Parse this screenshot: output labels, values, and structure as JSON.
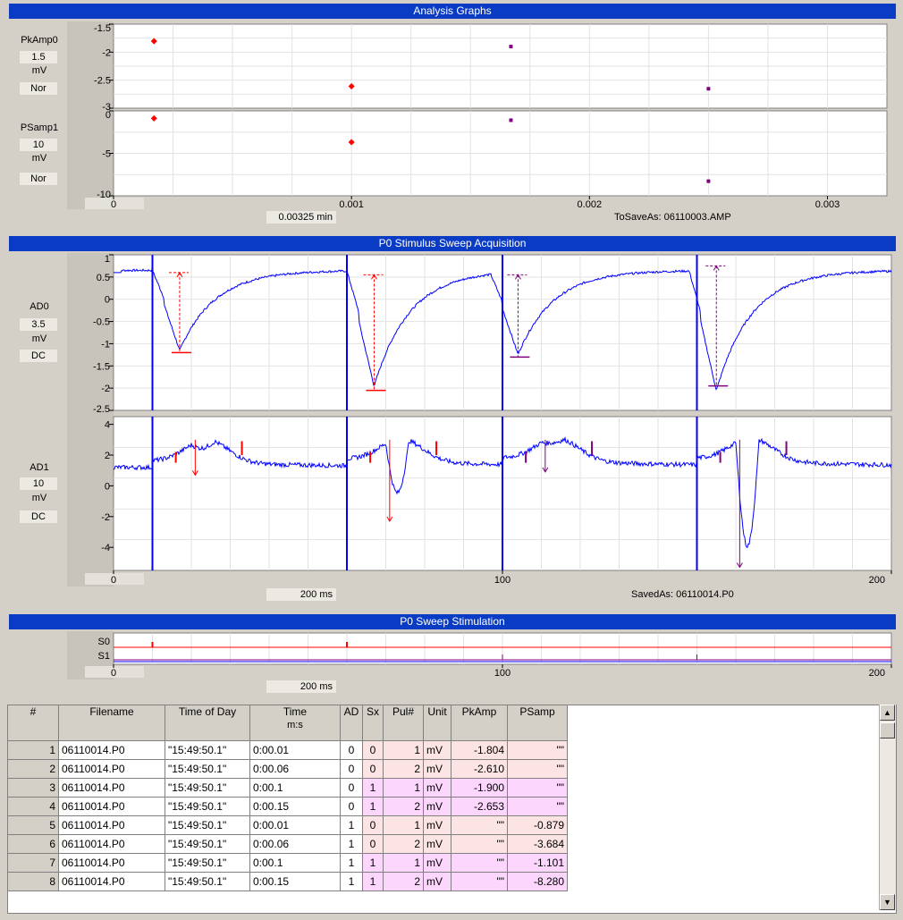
{
  "panels": {
    "analysis": {
      "title": "Analysis Graphs",
      "channels": [
        {
          "name": "PkAmp0",
          "scale": "1.5",
          "unit": "mV",
          "mode": "Nor",
          "yticks": [
            "-1.5",
            "-2",
            "-2.5",
            "-3"
          ]
        },
        {
          "name": "PSamp1",
          "scale": "10",
          "unit": "mV",
          "mode": "Nor",
          "yticks": [
            "0",
            "-5",
            "-10"
          ]
        }
      ],
      "xticks": [
        "0",
        "0.001",
        "0.002",
        "0.003"
      ],
      "xspan": "0.00325 min",
      "file_label": "ToSaveAs: 06110003.AMP"
    },
    "acquisition": {
      "title": "P0 Stimulus Sweep Acquisition",
      "channels": [
        {
          "name": "AD0",
          "scale": "3.5",
          "unit": "mV",
          "mode": "DC",
          "yticks": [
            "1",
            "0.5",
            "0",
            "-0.5",
            "-1",
            "-1.5",
            "-2",
            "-2.5"
          ]
        },
        {
          "name": "AD1",
          "scale": "10",
          "unit": "mV",
          "mode": "DC",
          "yticks": [
            "4",
            "2",
            "0",
            "-2",
            "-4"
          ]
        }
      ],
      "xticks": [
        "0",
        "100",
        "200"
      ],
      "xspan": "200 ms",
      "file_label": "SavedAs: 06110014.P0"
    },
    "stimulation": {
      "title": "P0 Sweep Stimulation",
      "channels": [
        "S0",
        "S1"
      ],
      "xticks": [
        "0",
        "100",
        "200"
      ],
      "xspan": "200 ms"
    }
  },
  "chart_data": [
    {
      "type": "scatter",
      "title": "PkAmp0",
      "ylim": [
        -3,
        -1.5
      ],
      "xlim": [
        0,
        0.00325
      ],
      "series": [
        {
          "values": [
            [
              0.00017,
              -1.804
            ],
            [
              0.001,
              -2.61
            ]
          ]
        },
        {
          "values": [
            [
              0.00167,
              -1.9
            ],
            [
              0.0025,
              -2.653
            ]
          ]
        }
      ]
    },
    {
      "type": "scatter",
      "title": "PSamp1",
      "ylim": [
        -10,
        0
      ],
      "xlim": [
        0,
        0.00325
      ],
      "series": [
        {
          "values": [
            [
              0.00017,
              -0.879
            ],
            [
              0.001,
              -3.684
            ]
          ]
        },
        {
          "values": [
            [
              0.00167,
              -1.101
            ],
            [
              0.0025,
              -8.28
            ]
          ]
        }
      ]
    },
    {
      "type": "line",
      "title": "AD0",
      "xlim": [
        0,
        200
      ],
      "ylim": [
        -2.5,
        1
      ],
      "stim_times": [
        10,
        60,
        100,
        150
      ],
      "peaks": [
        {
          "t": 17,
          "baseline": 0.6,
          "peak": -1.2
        },
        {
          "t": 67,
          "baseline": 0.55,
          "peak": -2.05
        },
        {
          "t": 104,
          "baseline": 0.55,
          "peak": -1.3
        },
        {
          "t": 155,
          "baseline": 0.75,
          "peak": -1.95
        }
      ]
    },
    {
      "type": "line",
      "title": "AD1",
      "xlim": [
        0,
        200
      ],
      "ylim": [
        -5.5,
        4.5
      ],
      "stim_times": [
        10,
        60,
        100,
        150
      ]
    }
  ],
  "table": {
    "headers": [
      "#",
      "Filename",
      "Time of Day",
      "Time\nm:s",
      "AD",
      "Sx",
      "Pul#",
      "Unit",
      "PkAmp",
      "PSamp"
    ],
    "header_time_line1": "Time",
    "header_time_line2": "m:s",
    "rows": [
      {
        "n": "1",
        "file": "06110014.P0",
        "tod": "\"15:49:50.1\"",
        "time": "0:00.01",
        "ad": "0",
        "sx": "0",
        "pul": "1",
        "unit": "mV",
        "pk": "-1.804",
        "ps": "\"\""
      },
      {
        "n": "2",
        "file": "06110014.P0",
        "tod": "\"15:49:50.1\"",
        "time": "0:00.06",
        "ad": "0",
        "sx": "0",
        "pul": "2",
        "unit": "mV",
        "pk": "-2.610",
        "ps": "\"\""
      },
      {
        "n": "3",
        "file": "06110014.P0",
        "tod": "\"15:49:50.1\"",
        "time": "0:00.1",
        "ad": "0",
        "sx": "1",
        "pul": "1",
        "unit": "mV",
        "pk": "-1.900",
        "ps": "\"\""
      },
      {
        "n": "4",
        "file": "06110014.P0",
        "tod": "\"15:49:50.1\"",
        "time": "0:00.15",
        "ad": "0",
        "sx": "1",
        "pul": "2",
        "unit": "mV",
        "pk": "-2.653",
        "ps": "\"\""
      },
      {
        "n": "5",
        "file": "06110014.P0",
        "tod": "\"15:49:50.1\"",
        "time": "0:00.01",
        "ad": "1",
        "sx": "0",
        "pul": "1",
        "unit": "mV",
        "pk": "\"\"",
        "ps": "-0.879"
      },
      {
        "n": "6",
        "file": "06110014.P0",
        "tod": "\"15:49:50.1\"",
        "time": "0:00.06",
        "ad": "1",
        "sx": "0",
        "pul": "2",
        "unit": "mV",
        "pk": "\"\"",
        "ps": "-3.684"
      },
      {
        "n": "7",
        "file": "06110014.P0",
        "tod": "\"15:49:50.1\"",
        "time": "0:00.1",
        "ad": "1",
        "sx": "1",
        "pul": "1",
        "unit": "mV",
        "pk": "\"\"",
        "ps": "-1.101"
      },
      {
        "n": "8",
        "file": "06110014.P0",
        "tod": "\"15:49:50.1\"",
        "time": "0:00.15",
        "ad": "1",
        "sx": "1",
        "pul": "2",
        "unit": "mV",
        "pk": "\"\"",
        "ps": "-8.280"
      }
    ]
  },
  "colors": {
    "title_bar": "#0a3bc4",
    "trace": "#0000ff",
    "marker_red": "#ff0000",
    "marker_purple": "#800080",
    "sx0_bg": "#fde4e4",
    "sx1_bg": "#fcd6fc"
  }
}
